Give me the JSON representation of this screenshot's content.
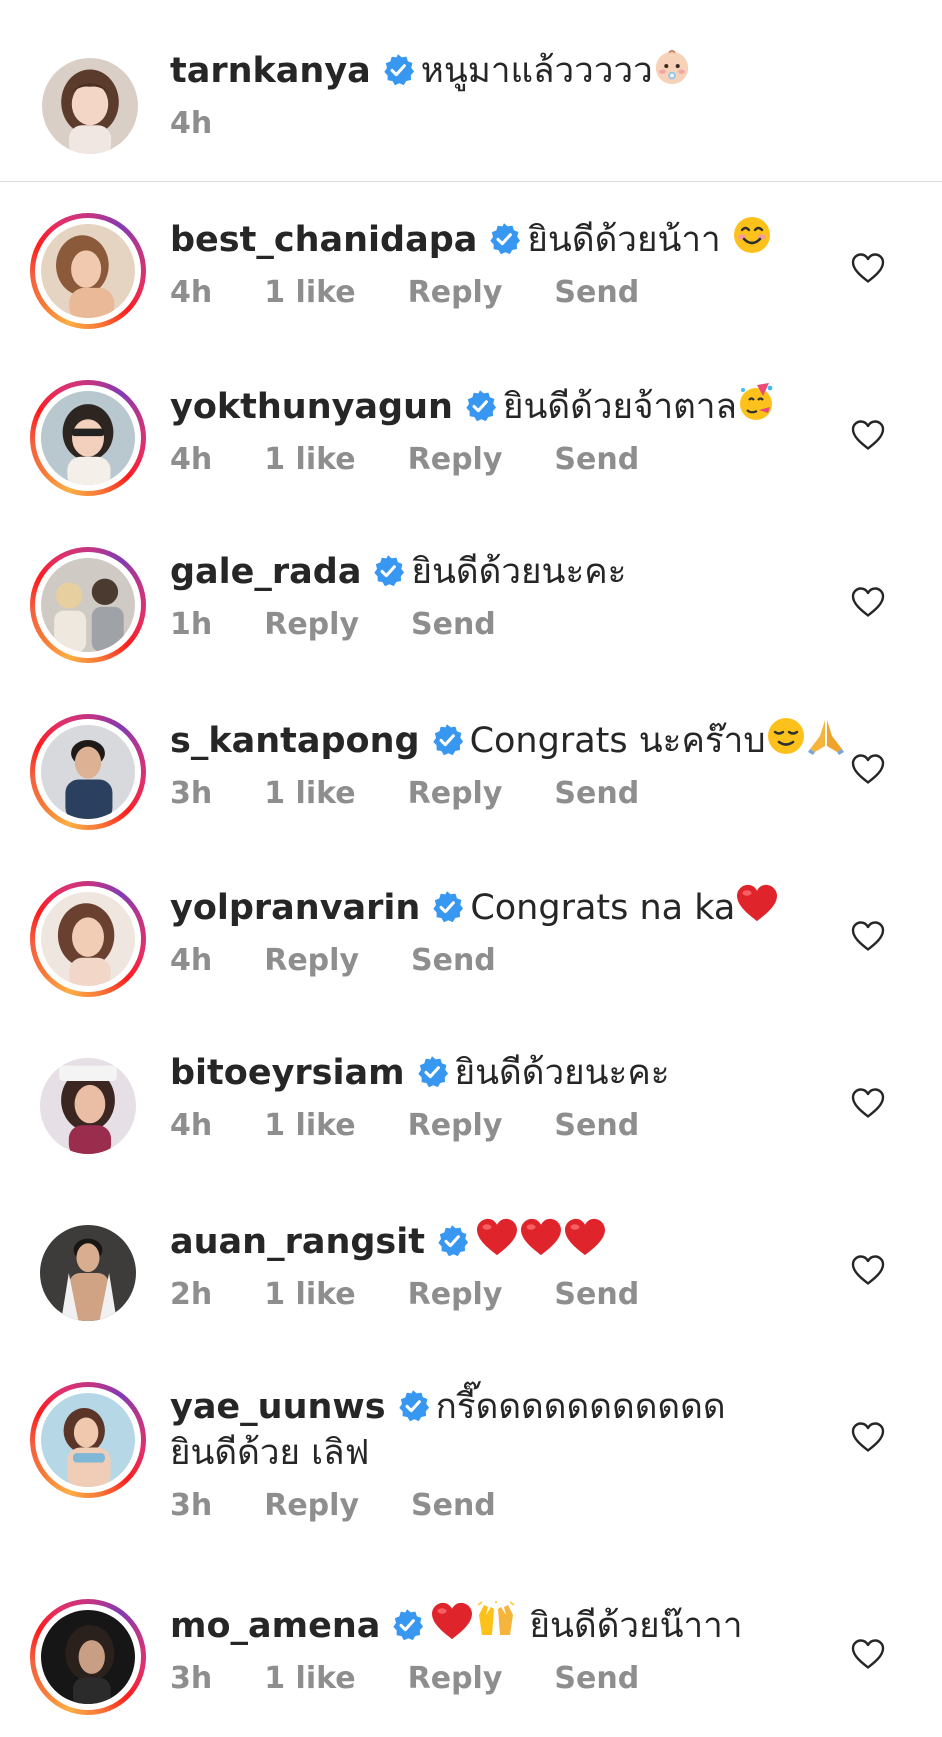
{
  "caption": {
    "username": "tarnkanya",
    "text": "หนูมาแล้ววววว",
    "emoji": "baby-face",
    "time": "4h"
  },
  "actions": {
    "reply": "Reply",
    "send": "Send"
  },
  "comments": [
    {
      "username": "best_chanidapa",
      "text": "ยินดีด้วยน้าา",
      "time": "4h",
      "likes": "1 like"
    },
    {
      "username": "yokthunyagun",
      "text": "ยินดีด้วยจ้าตาล",
      "time": "4h",
      "likes": "1 like"
    },
    {
      "username": "gale_rada",
      "text": "ยินดีด้วยนะคะ",
      "time": "1h",
      "likes": ""
    },
    {
      "username": "s_kantapong",
      "text": "Congrats นะคร๊าบ",
      "time": "3h",
      "likes": "1 like"
    },
    {
      "username": "yolpranvarin",
      "text": "Congrats na ka",
      "time": "4h",
      "likes": ""
    },
    {
      "username": "bitoeyrsiam",
      "text": "ยินดีด้วยนะคะ",
      "time": "4h",
      "likes": "1 like"
    },
    {
      "username": "auan_rangsit",
      "text": "",
      "time": "2h",
      "likes": "1 like"
    },
    {
      "username": "yae_uunws",
      "text": "กรี๊ดดดดดดดดดดด ยินดีด้วย เลิฟ",
      "time": "3h",
      "likes": ""
    },
    {
      "username": "mo_amena",
      "text": "ยินดีด้วยน๊าาา",
      "time": "3h",
      "likes": "1 like"
    }
  ],
  "colors": {
    "verified": "#3897f0",
    "meta": "#8e8e8e",
    "heart-red": "#e0242b"
  }
}
